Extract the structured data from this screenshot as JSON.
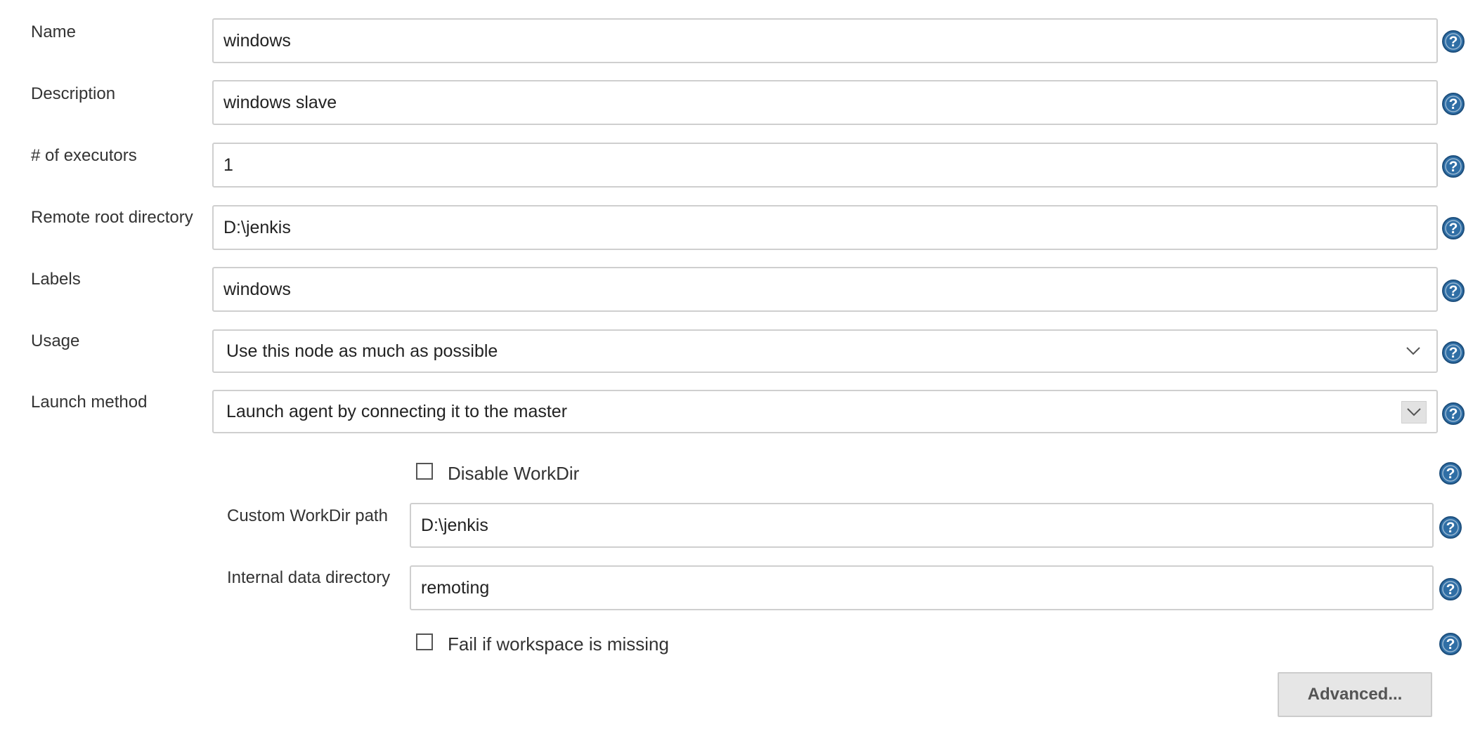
{
  "form": {
    "name": {
      "label": "Name",
      "value": "windows"
    },
    "description": {
      "label": "Description",
      "value": "windows slave"
    },
    "executors": {
      "label": "# of executors",
      "value": "1"
    },
    "remote_root": {
      "label": "Remote root directory",
      "value": "D:\\jenkis"
    },
    "labels": {
      "label": "Labels",
      "value": "windows"
    },
    "usage": {
      "label": "Usage",
      "selected": "Use this node as much as possible"
    },
    "launch_method": {
      "label": "Launch method",
      "selected": "Launch agent by connecting it to the master"
    }
  },
  "launch_options": {
    "disable_workdir": {
      "label": "Disable WorkDir",
      "checked": false
    },
    "custom_workdir": {
      "label": "Custom WorkDir path",
      "value": "D:\\jenkis"
    },
    "internal_data_dir": {
      "label": "Internal data directory",
      "value": "remoting"
    },
    "fail_if_missing": {
      "label": "Fail if workspace is missing",
      "checked": false
    },
    "advanced_button": "Advanced..."
  },
  "icons": {
    "help": "help-circle-icon",
    "dropdown": "chevron-down-icon"
  },
  "colors": {
    "help_icon_fill": "#2f6ea5",
    "border": "#cfcfcf",
    "button_bg": "#e6e6e6"
  }
}
